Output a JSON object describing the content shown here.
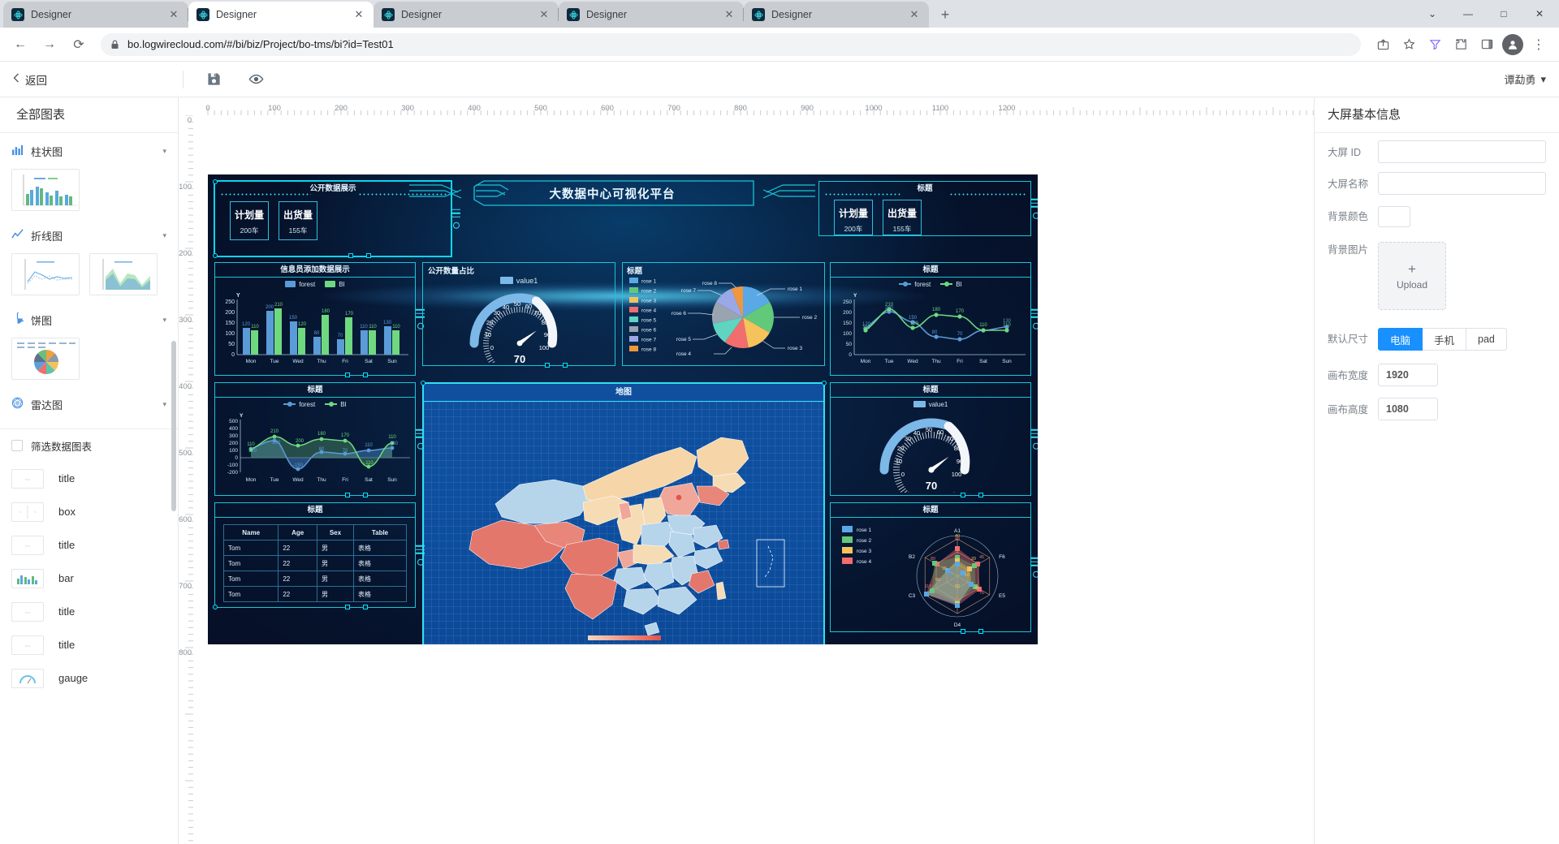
{
  "browser": {
    "tabs": [
      {
        "label": "Designer",
        "active": false
      },
      {
        "label": "Designer",
        "active": true
      },
      {
        "label": "Designer",
        "active": false
      },
      {
        "label": "Designer",
        "active": false
      },
      {
        "label": "Designer",
        "active": false
      }
    ],
    "newtab_label": "+",
    "url": "bo.logwirecloud.com/#/bi/biz/Project/bo-tms/bi?id=Test01",
    "win": {
      "minimize": "—",
      "maximize": "□",
      "close": "✕",
      "chevron": "⌄"
    }
  },
  "appbar": {
    "back_label": "返回",
    "save_icon": "save-icon",
    "preview_icon": "eye-icon",
    "user_name": "谭勐勇",
    "user_caret": "▾"
  },
  "left_panel": {
    "title": "全部图表",
    "categories": [
      {
        "label": "柱状图",
        "icon": "bar-chart-icon",
        "caret": "▾"
      },
      {
        "label": "折线图",
        "icon": "line-chart-icon",
        "caret": "▾"
      },
      {
        "label": "饼图",
        "icon": "pie-chart-icon",
        "caret": "▾"
      },
      {
        "label": "雷达图",
        "icon": "radar-chart-icon",
        "caret": "▾"
      }
    ],
    "filter_label": "筛选数据图表",
    "widgets": [
      {
        "label": "title",
        "icon": "text-widget-icon"
      },
      {
        "label": "box",
        "icon": "box-widget-icon"
      },
      {
        "label": "title",
        "icon": "text-widget-icon"
      },
      {
        "label": "bar",
        "icon": "bar-widget-icon"
      },
      {
        "label": "title",
        "icon": "text-widget-icon"
      },
      {
        "label": "title",
        "icon": "text-widget-icon"
      },
      {
        "label": "gauge",
        "icon": "gauge-widget-icon"
      }
    ]
  },
  "ruler": {
    "h_labels": [
      "0",
      "100",
      "200",
      "300",
      "400",
      "500",
      "600",
      "700",
      "800",
      "900",
      "1000",
      "1100",
      "1200"
    ],
    "v_labels": [
      "0",
      "100",
      "200",
      "300",
      "400",
      "500",
      "600",
      "700",
      "800"
    ]
  },
  "right_panel": {
    "title": "大屏基本信息",
    "fields": {
      "id_label": "大屏 ID",
      "id_value": "",
      "id_placeholder": "",
      "name_label": "大屏名称",
      "name_value": "",
      "name_placeholder": "",
      "bgcolor_label": "背景颜色",
      "bgcolor_value": "#ffffff",
      "bgimage_label": "背景图片",
      "upload_plus": "+",
      "upload_text": "Upload",
      "size_label": "默认尺寸",
      "size_options": [
        "电脑",
        "手机",
        "pad"
      ],
      "size_selected": "电脑",
      "width_label": "画布宽度",
      "width_value": "1920",
      "height_label": "画布高度",
      "height_value": "1080"
    }
  },
  "canvas": {
    "colors": {
      "accent": "#19c5d8",
      "glow": "#2fe0f5",
      "forest": "#5a9bd8",
      "bi": "#6fd97f",
      "title_text": "#eaf8ff",
      "gauge": "#7cb8e8"
    },
    "banner_title": "大数据中心可视化平台",
    "panels": {
      "public_data": {
        "title": "公开数据展示",
        "kpis": [
          {
            "label": "计划量",
            "value": "200车"
          },
          {
            "label": "出货量",
            "value": "155车"
          }
        ]
      },
      "top_right": {
        "title": "标题",
        "kpis": [
          {
            "label": "计划量",
            "value": "200车"
          },
          {
            "label": "出货量",
            "value": "155车"
          }
        ]
      },
      "bar_panel_title": "信息员添加数据展示",
      "gauge_panel_title": "公开数量占比",
      "rose_panel_title": "标题",
      "line_right_title": "标题",
      "area_panel_title": "标题",
      "map_panel_title": "地图",
      "table_panel_title": "标题",
      "gauge2_panel_title": "标题",
      "radar_panel_title": "标题"
    }
  },
  "chart_data": [
    {
      "id": "bar-chart",
      "type": "bar",
      "title": "信息员添加数据展示",
      "categories": [
        "Mon",
        "Tue",
        "Wed",
        "Thu",
        "Fri",
        "Sat",
        "Sun"
      ],
      "series": [
        {
          "name": "forest",
          "color": "#5a9bd8",
          "values": [
            120,
            200,
            150,
            80,
            70,
            110,
            130
          ]
        },
        {
          "name": "BI",
          "color": "#6fd97f",
          "values": [
            110,
            210,
            120,
            180,
            170,
            110,
            110
          ]
        }
      ],
      "ylabel": "Y",
      "yticks": [
        0,
        50,
        100,
        150,
        200,
        250
      ],
      "ylim": [
        0,
        250
      ],
      "legend": "top",
      "grid": false
    },
    {
      "id": "gauge-1",
      "type": "gauge",
      "title": "公开数量占比",
      "legend_label": "value1",
      "value": 70,
      "min": 0,
      "max": 100,
      "ticks": [
        0,
        10,
        20,
        30,
        40,
        50,
        60,
        70,
        80,
        90,
        100
      ]
    },
    {
      "id": "rose-pie",
      "type": "pie",
      "title": "标题",
      "labels": [
        "rose 1",
        "rose 2",
        "rose 3",
        "rose 4",
        "rose 5",
        "rose 6",
        "rose 7",
        "rose 8"
      ],
      "values": [
        14,
        14,
        13,
        12,
        12,
        12,
        12,
        11
      ],
      "colors": [
        "#5aa9e6",
        "#62c97a",
        "#f5c25b",
        "#f26d6d",
        "#5fd4c0",
        "#9aa4b0",
        "#9aa8e6",
        "#f0963c"
      ],
      "legend": "left"
    },
    {
      "id": "line-right",
      "type": "line",
      "title": "标题",
      "categories": [
        "Mon",
        "Tue",
        "Wed",
        "Thu",
        "Fri",
        "Sat",
        "Sun"
      ],
      "series": [
        {
          "name": "forest",
          "color": "#5a9bd8",
          "values": [
            120,
            200,
            150,
            80,
            70,
            110,
            130
          ]
        },
        {
          "name": "BI",
          "color": "#6fd97f",
          "values": [
            110,
            210,
            120,
            180,
            170,
            110,
            110
          ]
        }
      ],
      "ylabel": "Y",
      "yticks": [
        0,
        50,
        100,
        150,
        200,
        250
      ],
      "ylim": [
        0,
        250
      ],
      "legend": "top"
    },
    {
      "id": "area-left",
      "type": "area",
      "title": "标题",
      "categories": [
        "Mon",
        "Tue",
        "Wed",
        "Thu",
        "Fri",
        "Sat",
        "Sun"
      ],
      "series": [
        {
          "name": "forest",
          "color": "#5a9bd8",
          "values": [
            120,
            230,
            -150,
            80,
            70,
            110,
            130
          ]
        },
        {
          "name": "BI",
          "color": "#6fd97f",
          "values": [
            110,
            210,
            200,
            180,
            170,
            -110,
            110
          ]
        }
      ],
      "ylabel": "Y",
      "yticks": [
        -200,
        -100,
        0,
        100,
        200,
        300,
        400,
        500
      ],
      "ylim": [
        -200,
        500
      ],
      "legend": "top"
    },
    {
      "id": "data-table",
      "type": "table",
      "title": "标题",
      "columns": [
        "Name",
        "Age",
        "Sex",
        "Table"
      ],
      "rows": [
        [
          "Tom",
          "22",
          "男",
          "表格"
        ],
        [
          "Tom",
          "22",
          "男",
          "表格"
        ],
        [
          "Tom",
          "22",
          "男",
          "表格"
        ],
        [
          "Tom",
          "22",
          "男",
          "表格"
        ]
      ]
    },
    {
      "id": "gauge-2",
      "type": "gauge",
      "title": "标题",
      "legend_label": "value1",
      "value": 70,
      "min": 0,
      "max": 100,
      "ticks": [
        0,
        10,
        20,
        30,
        40,
        50,
        60,
        70,
        80,
        90,
        100
      ]
    },
    {
      "id": "radar",
      "type": "radar",
      "title": "标题",
      "axes": [
        "A1",
        "F6",
        "E5",
        "D4",
        "C3",
        "B2"
      ],
      "labels": [
        "rose 1",
        "rose 2",
        "rose 3",
        "rose 4"
      ],
      "colors": [
        "#5aa9e6",
        "#62c97a",
        "#f5c25b",
        "#f26d6d"
      ],
      "series": [
        {
          "name": "rose 1",
          "values": [
            40,
            20,
            48,
            95,
            110,
            35
          ]
        },
        {
          "name": "rose 2",
          "values": [
            60,
            65,
            76,
            85,
            90,
            80
          ]
        },
        {
          "name": "rose 3",
          "values": [
            50,
            10,
            50,
            50,
            60,
            25
          ]
        },
        {
          "name": "rose 4",
          "values": [
            90,
            45,
            75,
            95,
            110,
            80
          ]
        }
      ],
      "max": 120
    },
    {
      "id": "china-map",
      "type": "map",
      "title": "地图",
      "region": "China"
    }
  ]
}
